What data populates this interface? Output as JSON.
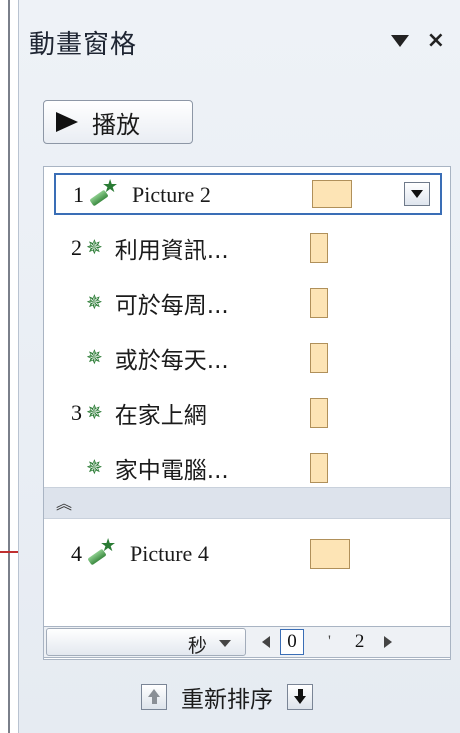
{
  "pane": {
    "title": "動畫窗格",
    "close_symbol": "×"
  },
  "play_button": {
    "label": "播放"
  },
  "list": {
    "items": [
      {
        "number": "1",
        "icon": "motion-path-star-icon",
        "label": "Picture 2",
        "selected": true,
        "swatch_color": "#fde4b5"
      },
      {
        "number": "2",
        "icon": "green-star-icon",
        "label": "利用資訊..."
      },
      {
        "number": "",
        "icon": "green-star-icon",
        "label": "可於每周..."
      },
      {
        "number": "",
        "icon": "green-star-icon",
        "label": "或於每天..."
      },
      {
        "number": "3",
        "icon": "green-star-icon",
        "label": "在家上網"
      },
      {
        "number": "",
        "icon": "green-star-icon",
        "label": "家中電腦..."
      },
      {
        "number": "4",
        "icon": "motion-path-star-icon",
        "label": "Picture 4",
        "swatch_color": "#fde4b5"
      }
    ],
    "collapse_icon": "collapse-chevrons-icon"
  },
  "timeline": {
    "unit_label": "秒",
    "start_value": "0",
    "tick_mark": "'",
    "end_value": "2"
  },
  "reorder": {
    "label": "重新排序"
  },
  "colors": {
    "accent": "#3a6eb6",
    "swatch": "#fde4b5",
    "star_green": "#2a7b34",
    "pane_bg": "#eef2f7"
  }
}
